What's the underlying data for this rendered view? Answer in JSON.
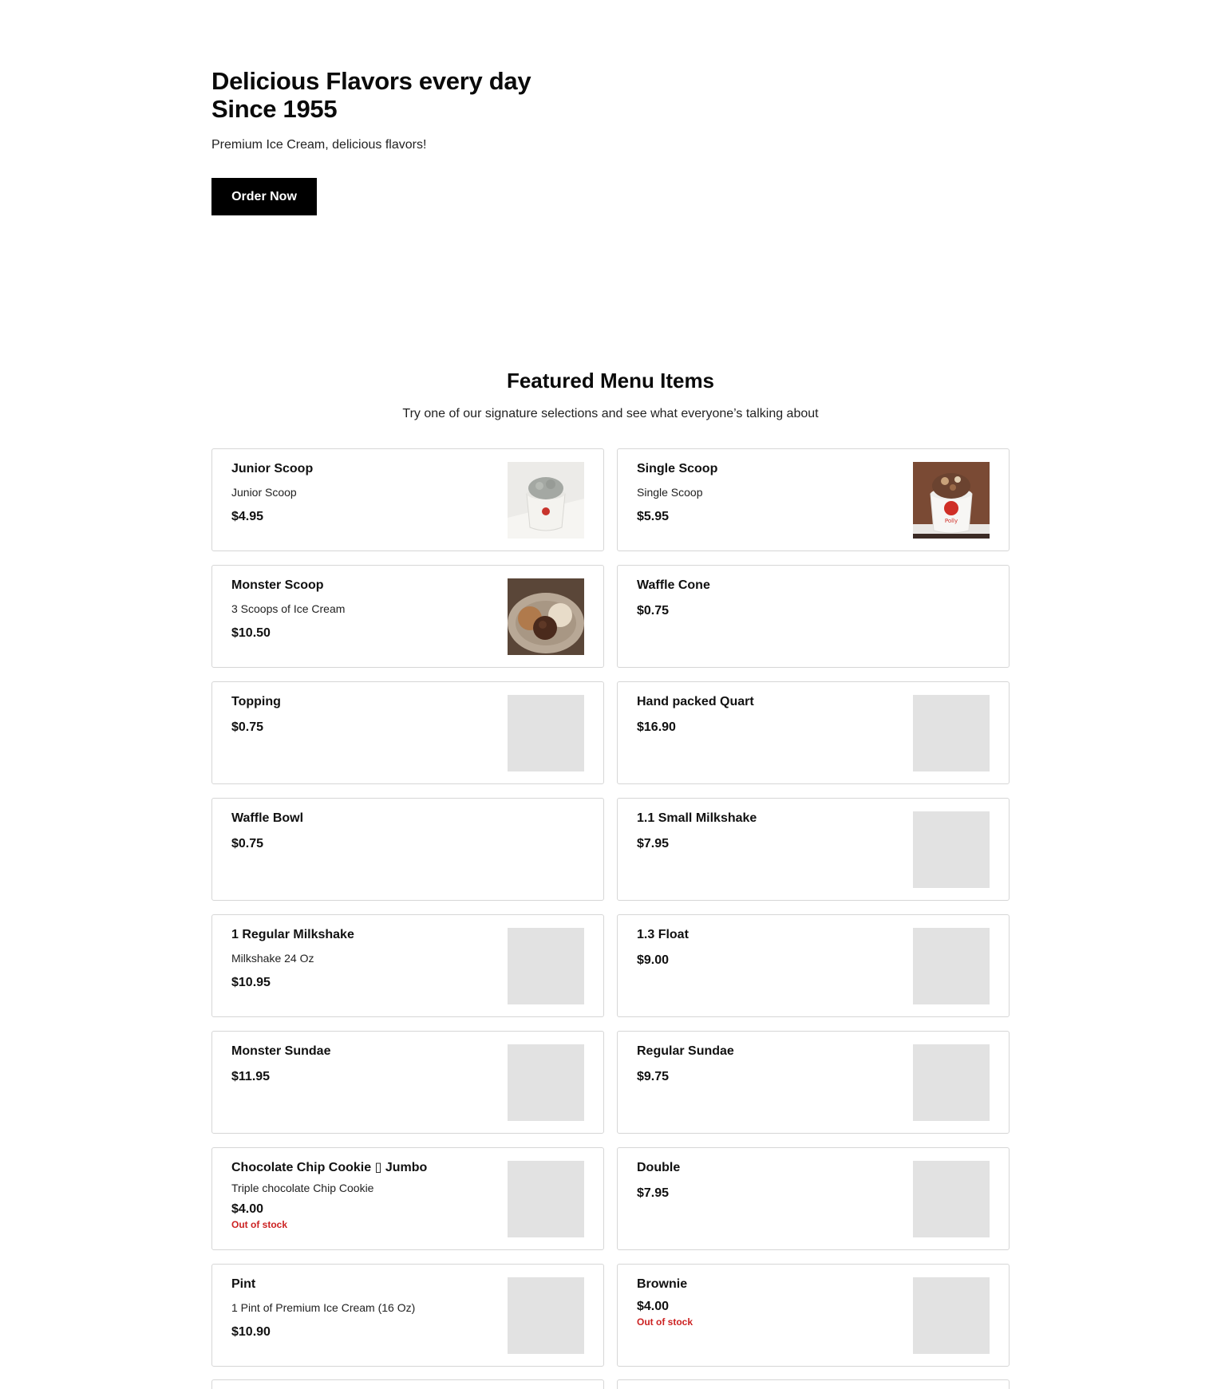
{
  "hero": {
    "title_line1": "Delicious Flavors every day",
    "title_line2": "Since 1955",
    "subtitle": "Premium Ice Cream, delicious flavors!",
    "cta_label": "Order Now"
  },
  "featured": {
    "title": "Featured Menu Items",
    "subtitle": "Try one of our signature selections and see what everyone’s talking about"
  },
  "menu_items": [
    {
      "name": "Junior Scoop",
      "description": "Junior Scoop",
      "price": "$4.95",
      "stock": "",
      "image": "junior-scoop-photo"
    },
    {
      "name": "Single Scoop",
      "description": "Single Scoop",
      "price": "$5.95",
      "stock": "",
      "image": "single-scoop-photo"
    },
    {
      "name": "Monster Scoop",
      "description": "3 Scoops of Ice Cream",
      "price": "$10.50",
      "stock": "",
      "image": "monster-scoop-photo"
    },
    {
      "name": "Waffle Cone",
      "description": "",
      "price": "$0.75",
      "stock": "",
      "image": ""
    },
    {
      "name": "Topping",
      "description": "",
      "price": "$0.75",
      "stock": "",
      "image": "placeholder"
    },
    {
      "name": "Hand packed Quart",
      "description": "",
      "price": "$16.90",
      "stock": "",
      "image": "placeholder"
    },
    {
      "name": "Waffle Bowl",
      "description": "",
      "price": "$0.75",
      "stock": "",
      "image": ""
    },
    {
      "name": "1.1 Small Milkshake",
      "description": "",
      "price": "$7.95",
      "stock": "",
      "image": "placeholder"
    },
    {
      "name": "1 Regular Milkshake",
      "description": "Milkshake 24 Oz",
      "price": "$10.95",
      "stock": "",
      "image": "placeholder"
    },
    {
      "name": "1.3 Float",
      "description": "",
      "price": "$9.00",
      "stock": "",
      "image": "placeholder"
    },
    {
      "name": "Monster Sundae",
      "description": "",
      "price": "$11.95",
      "stock": "",
      "image": "placeholder"
    },
    {
      "name": "Regular Sundae",
      "description": "",
      "price": "$9.75",
      "stock": "",
      "image": "placeholder"
    },
    {
      "name": "Chocolate Chip Cookie ▯ Jumbo",
      "description": "Triple chocolate Chip Cookie",
      "price": "$4.00",
      "stock": "Out of stock",
      "image": "placeholder"
    },
    {
      "name": "Double",
      "description": "",
      "price": "$7.95",
      "stock": "",
      "image": "placeholder"
    },
    {
      "name": "Pint",
      "description": "1 Pint of Premium Ice Cream (16 Oz)",
      "price": "$10.90",
      "stock": "",
      "image": "placeholder"
    },
    {
      "name": "Brownie",
      "description": "",
      "price": "$4.00",
      "stock": "Out of stock",
      "image": "placeholder"
    }
  ],
  "colors": {
    "button_bg": "#000000",
    "out_of_stock": "#cc2222",
    "card_border": "#d6d6d6",
    "image_placeholder": "#e2e2e2"
  }
}
